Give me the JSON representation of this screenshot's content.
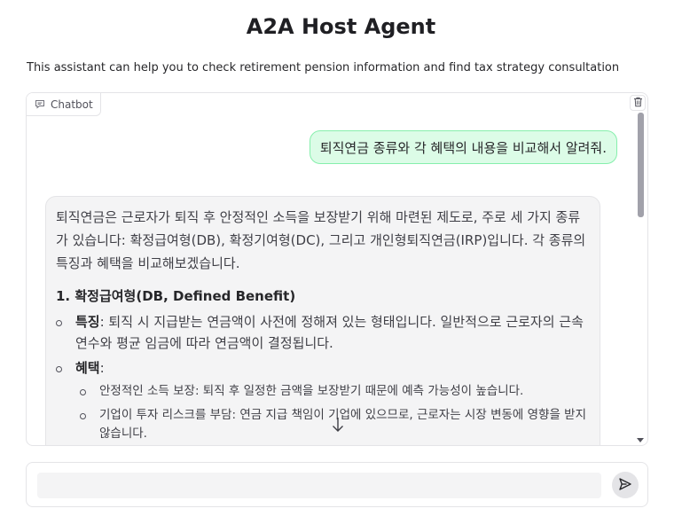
{
  "header": {
    "title": "A2A Host Agent",
    "description": "This assistant can help you to check retirement pension information and find tax strategy consultation"
  },
  "chatbot": {
    "label": "Chatbot",
    "label_icon": "chat-bubble-icon",
    "clear_icon": "trash-icon",
    "messages": {
      "user": "퇴직연금 종류와 각 혜택의 내용을 비교해서 알려줘.",
      "assistant": {
        "intro": "퇴직연금은 근로자가 퇴직 후 안정적인 소득을 보장받기 위해 마련된 제도로, 주로 세 가지 종류가 있습니다: 확정급여형(DB), 확정기여형(DC), 그리고 개인형퇴직연금(IRP)입니다. 각 종류의 특징과 혜택을 비교해보겠습니다.",
        "section1_heading": "1. 확정급여형(DB, Defined Benefit)",
        "feature_label": "특징",
        "feature_text": ": 퇴직 시 지급받는 연금액이 사전에 정해져 있는 형태입니다. 일반적으로 근로자의 근속연수와 평균 임금에 따라 연금액이 결정됩니다.",
        "benefit_label": "혜택",
        "benefit_colon": ":",
        "benefits": [
          "안정적인 소득 보장: 퇴직 후 일정한 금액을 보장받기 때문에 예측 가능성이 높습니다.",
          "기업이 투자 리스크를 부담: 연금 지급 책임이 기업에 있으므로, 근로자는 시장 변동에 영향을 받지 않습니다."
        ]
      }
    },
    "scroll_down_icon": "arrow-down-icon"
  },
  "input": {
    "value": "",
    "placeholder": "",
    "send_icon": "send-icon"
  },
  "colors": {
    "user_bubble_bg": "#dcfce7",
    "user_bubble_border": "#86efac",
    "bot_bubble_bg": "#f4f4f5"
  }
}
